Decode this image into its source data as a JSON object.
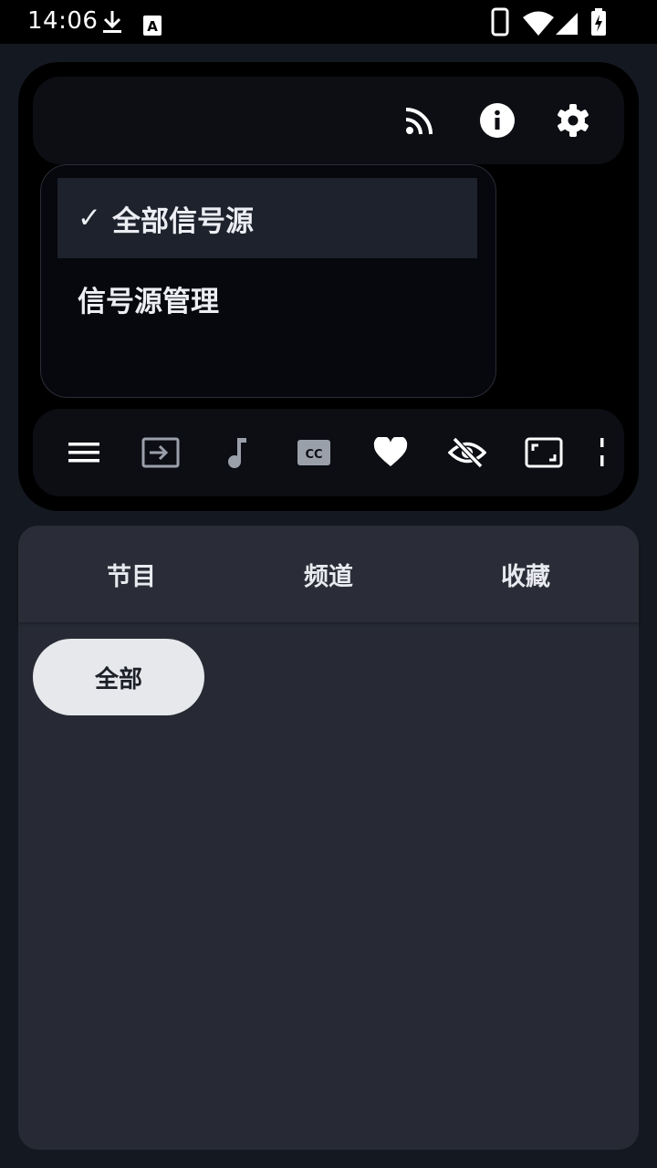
{
  "status_bar": {
    "time": "14:06",
    "icons": [
      "download-icon",
      "keyboard-a-icon",
      "phone-icon",
      "wifi-icon",
      "signal-icon",
      "battery-charging-icon"
    ]
  },
  "player": {
    "top_actions": [
      "cast-icon",
      "info-icon",
      "settings-icon"
    ],
    "source_menu": {
      "items": [
        {
          "label": "全部信号源",
          "selected": true,
          "check": "✓"
        },
        {
          "label": "信号源管理",
          "selected": false
        }
      ]
    },
    "controls": [
      "menu-icon",
      "input-switch-icon",
      "audio-track-icon",
      "subtitles-icon",
      "favorite-icon",
      "hide-icon",
      "aspect-ratio-icon",
      "more-icon"
    ]
  },
  "tabs": [
    {
      "label": "节目"
    },
    {
      "label": "频道"
    },
    {
      "label": "收藏"
    }
  ],
  "filter_chip": {
    "label": "全部"
  },
  "colors": {
    "background": "#141820",
    "panel": "#272a34",
    "chip": "#e7e8ec",
    "menu_selected": "#1e222c"
  }
}
